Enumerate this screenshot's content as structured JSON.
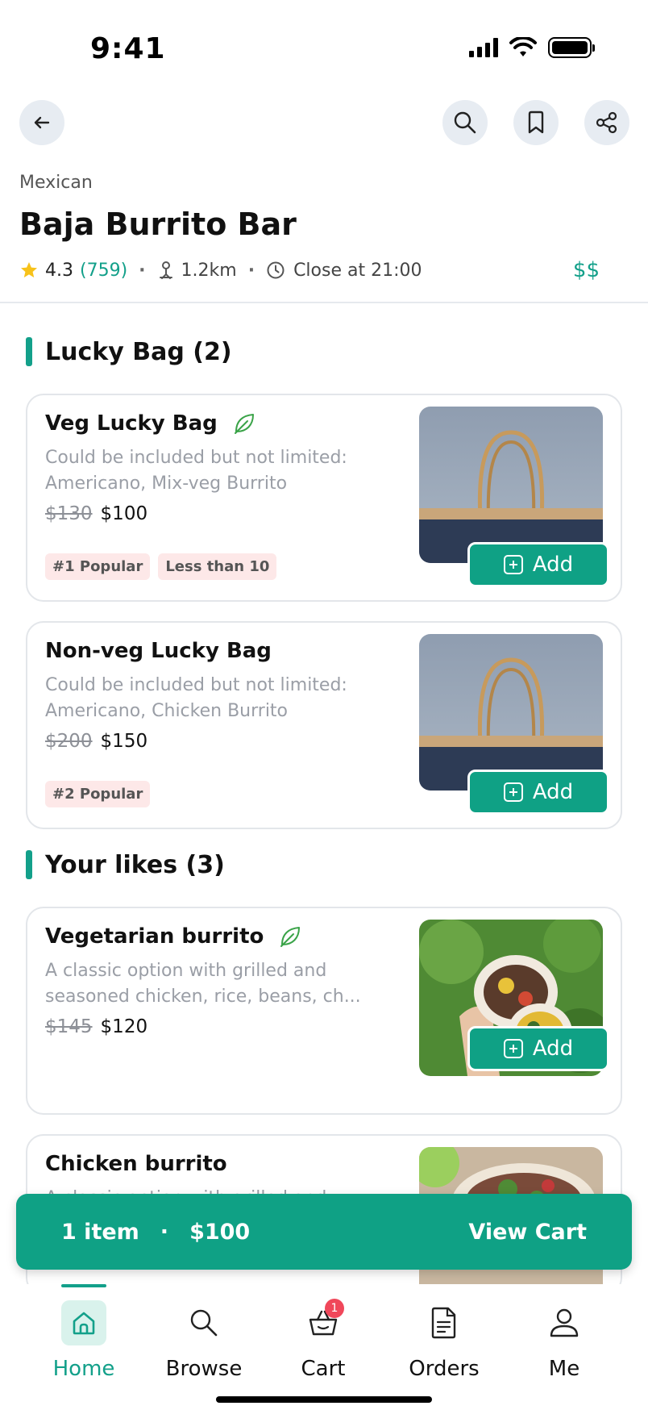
{
  "status_bar": {
    "time": "9:41"
  },
  "header": {
    "cuisine": "Mexican",
    "name": "Baja Burrito Bar",
    "rating": "4.3",
    "review_count": "(759)",
    "distance": "1.2km",
    "hours": "Close at 21:00",
    "price_level": "$$"
  },
  "sections": [
    {
      "title": "Lucky Bag (2)",
      "items": [
        {
          "name": "Veg Lucky Bag",
          "veg": true,
          "desc": "Could be included but not limited: Americano, Mix-veg Burrito",
          "old_price": "$130",
          "price": "$100",
          "tags": [
            "#1 Popular",
            "Less than 10"
          ],
          "add_label": "Add"
        },
        {
          "name": "Non-veg Lucky Bag",
          "veg": false,
          "desc": "Could be included but not limited: Americano, Chicken Burrito",
          "old_price": "$200",
          "price": "$150",
          "tags": [
            "#2 Popular"
          ],
          "add_label": "Add"
        }
      ]
    },
    {
      "title": "Your likes (3)",
      "items": [
        {
          "name": "Vegetarian burrito",
          "veg": true,
          "desc": "A classic option with grilled and seasoned chicken, rice, beans, ch...",
          "old_price": "$145",
          "price": "$120",
          "tags": [],
          "add_label": "Add"
        },
        {
          "name": "Chicken burrito",
          "veg": false,
          "desc": "A classic option with grilled and",
          "old_price": "",
          "price": "",
          "tags": [],
          "add_label": "Add"
        }
      ]
    }
  ],
  "cart_bar": {
    "items": "1 item",
    "separator": "·",
    "total": "$100",
    "action": "View Cart"
  },
  "bottom_nav": [
    {
      "label": "Home",
      "icon": "home-icon",
      "active": true
    },
    {
      "label": "Browse",
      "icon": "search-icon",
      "active": false
    },
    {
      "label": "Cart",
      "icon": "basket-icon",
      "active": false,
      "badge": "1"
    },
    {
      "label": "Orders",
      "icon": "document-icon",
      "active": false
    },
    {
      "label": "Me",
      "icon": "user-icon",
      "active": false
    }
  ],
  "colors": {
    "accent": "#0fa185",
    "tag_bg": "#fde8e8",
    "badge": "#f0475a"
  }
}
